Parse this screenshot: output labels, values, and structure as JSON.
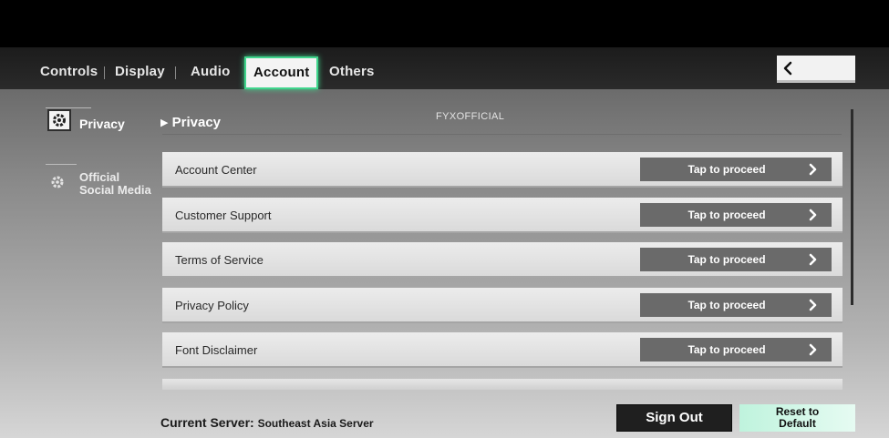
{
  "tabs": [
    {
      "label": "Controls"
    },
    {
      "label": "Display"
    },
    {
      "label": "Audio"
    },
    {
      "label": "Account"
    },
    {
      "label": "Others"
    }
  ],
  "sidebar": {
    "items": [
      {
        "label": "Privacy",
        "active": true
      },
      {
        "label_line1": "Official",
        "label_line2": "Social Media",
        "active": false
      }
    ]
  },
  "section": {
    "title": "Privacy",
    "watermark": "FYXOFFICIAL"
  },
  "rows": [
    {
      "label": "Account Center",
      "action": "Tap to proceed"
    },
    {
      "label": "Customer Support",
      "action": "Tap to proceed"
    },
    {
      "label": "Terms of Service",
      "action": "Tap to proceed"
    },
    {
      "label": "Privacy Policy",
      "action": "Tap to proceed"
    },
    {
      "label": "Font Disclaimer",
      "action": "Tap to proceed"
    }
  ],
  "footer": {
    "server_label": "Current Server:",
    "server_value": "Southeast Asia Server",
    "sign_out": "Sign Out",
    "reset": "Reset to\nDefault"
  },
  "icons": {
    "back": "chevron-left-icon",
    "nav": "gear-icon",
    "row_arrow": "chevron-right-icon"
  },
  "colors": {
    "accent": "#3fd58c",
    "reset_bg": "#bff3dd",
    "signout_bg": "#1f1f1f"
  }
}
